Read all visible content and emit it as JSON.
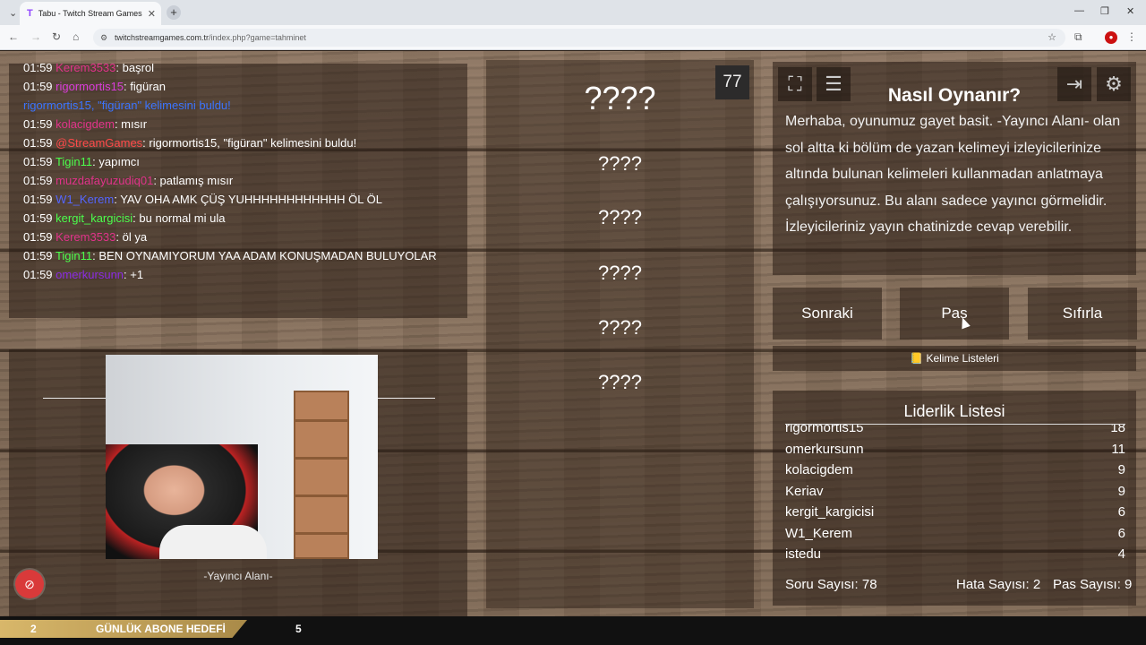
{
  "browser": {
    "tab_title": "Tabu - Twitch Stream Games",
    "tab_favicon": "T",
    "url_main": "twitchstreamgames.com.tr",
    "url_path": "/index.php?game=tahminet"
  },
  "chat": {
    "messages": [
      {
        "time": "01:59",
        "user": "Kerem3533",
        "sep": ": ",
        "text": "başrol",
        "color": "#e0338a"
      },
      {
        "time": "01:59",
        "user": "rigormortis15",
        "sep": ": ",
        "text": "figüran",
        "color": "#d93cd9"
      },
      {
        "time": "",
        "user": "rigormortis15, \"figüran\" kelimesini buldu!",
        "sep": "",
        "text": "",
        "color": "#3b74ff"
      },
      {
        "time": "01:59",
        "user": "kolacigdem",
        "sep": ": ",
        "text": "mısır",
        "color": "#e0338a"
      },
      {
        "time": "01:59",
        "user": "@StreamGames",
        "sep": ": ",
        "text": "rigormortis15, \"figüran\" kelimesini buldu!",
        "color": "#ff4a4a"
      },
      {
        "time": "01:59",
        "user": "Tigin11",
        "sep": ": ",
        "text": "yapımcı",
        "color": "#4cff4c"
      },
      {
        "time": "01:59",
        "user": "muzdafayuzudiq01",
        "sep": ": ",
        "text": "patlamış mısır",
        "color": "#e0338a"
      },
      {
        "time": "01:59",
        "user": "W1_Kerem",
        "sep": ": ",
        "text": "YAV OHA AMK ÇÜŞ YUHHHHHHHHHHHH ÖL ÖL",
        "color": "#5566ff"
      },
      {
        "time": "01:59",
        "user": "kergit_kargicisi",
        "sep": ": ",
        "text": "bu normal mi ula",
        "color": "#4cff4c"
      },
      {
        "time": "01:59",
        "user": "Kerem3533",
        "sep": ": ",
        "text": "öl ya",
        "color": "#e0338a"
      },
      {
        "time": "01:59",
        "user": "Tigin11",
        "sep": ": ",
        "text": "BEN OYNAMIYORUM YAA ADAM KONUŞMADAN BULUYOLAR",
        "color": "#4cff4c"
      },
      {
        "time": "01:59",
        "user": "omerkursunn",
        "sep": ": ",
        "text": "+1",
        "color": "#8a2be2"
      }
    ]
  },
  "streamer": {
    "label": "-Yayıncı Alanı-",
    "record_icon": "no-entry-icon"
  },
  "game": {
    "timer": "77",
    "words": [
      "????",
      "????",
      "????",
      "????",
      "????",
      "????"
    ]
  },
  "howto": {
    "title": "Nasıl Oynanır?",
    "text": "Merhaba, oyunumuz gayet basit. -Yayıncı Alanı- olan sol altta ki bölüm de yazan kelimeyi izleyicilerinize altında bulunan kelimeleri kullanmadan anlatmaya çalışıyorsunuz. Bu alanı sadece yayıncı görmelidir. İzleyicileriniz yayın chatinizde cevap verebilir.",
    "icons": [
      "fullscreen-icon",
      "list-icon",
      "exit-icon",
      "gear-icon"
    ]
  },
  "controls": {
    "next": "Sonraki",
    "pass": "Pas",
    "reset": "Sıfırla",
    "wordlists": "Kelime Listeleri",
    "wordlists_icon": "📒"
  },
  "leaderboard": {
    "title": "Liderlik Listesi",
    "rows": [
      {
        "name": "rigormortis15",
        "score": "18"
      },
      {
        "name": "omerkursunn",
        "score": "11"
      },
      {
        "name": "kolacigdem",
        "score": "9"
      },
      {
        "name": "Keriav",
        "score": "9"
      },
      {
        "name": "kergit_kargicisi",
        "score": "6"
      },
      {
        "name": "W1_Kerem",
        "score": "6"
      },
      {
        "name": "istedu",
        "score": "4"
      }
    ],
    "question_count": "Soru Sayısı: 78",
    "error_count": "Hata Sayısı: 2",
    "pass_count": "Pas Sayısı: 9"
  },
  "sub_goal": {
    "current": "2",
    "label": "GÜNLÜK ABONE HEDEFİ",
    "target": "5",
    "progress_fraction": 0.4
  }
}
